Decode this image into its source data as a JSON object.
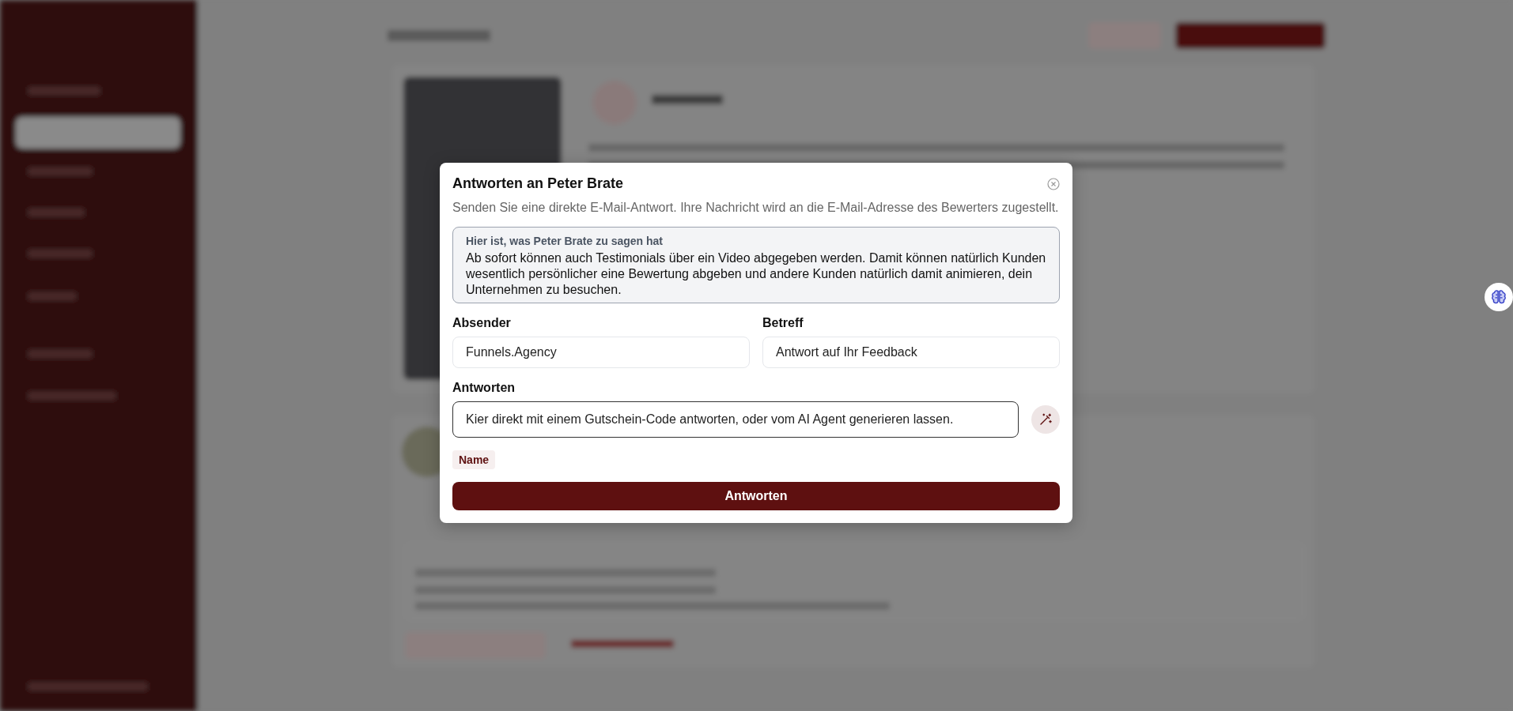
{
  "dialog": {
    "title": "Antworten an Peter Brate",
    "description": "Senden Sie eine direkte E-Mail-Antwort. Ihre Nachricht wird an die E-Mail-Adresse des Bewerters zugestellt.",
    "quote": {
      "label": "Hier ist, was Peter Brate zu sagen hat",
      "text": "Ab sofort können auch Testimonials über ein Video abgegeben werden. Damit können natürlich Kunden wesentlich persönlicher eine Bewertung abgeben und andere Kunden natürlich damit animieren, dein Unternehmen zu besuchen."
    },
    "fields": [
      {
        "label": "Absender",
        "value": "Funnels.Agency"
      },
      {
        "label": "Betreff",
        "value": "Antwort auf Ihr Feedback"
      }
    ],
    "reply": {
      "label": "Antworten",
      "value": "Kier direkt mit einem Gutschein-Code antworten, oder vom AI Agent generieren lassen."
    },
    "chips": [
      "Name"
    ],
    "submit": "Antworten"
  }
}
